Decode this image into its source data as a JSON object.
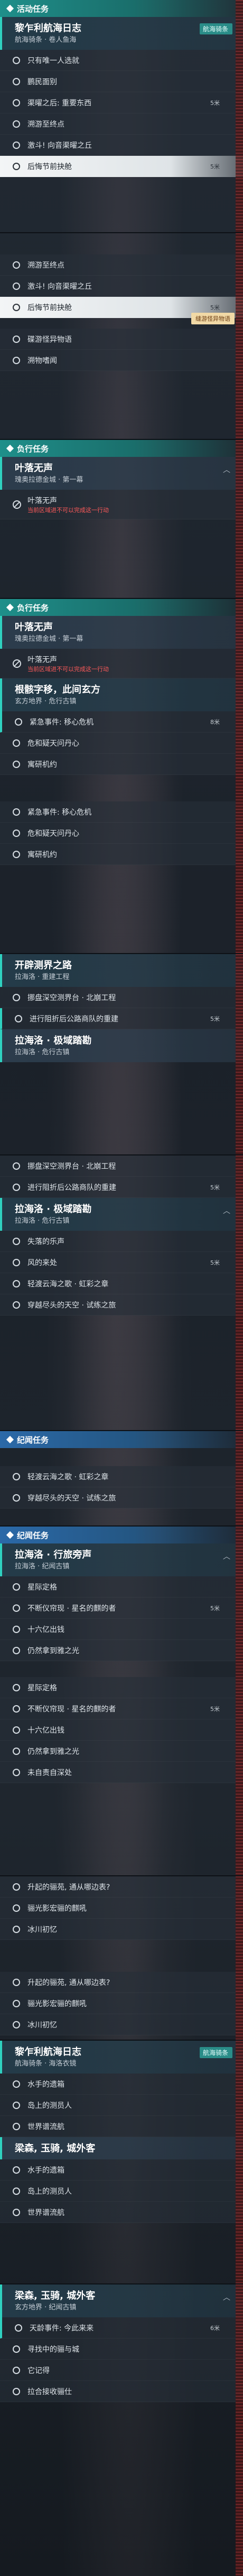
{
  "sections": {
    "activity": "活动任务",
    "side": "负行任务",
    "chronicle": "纪闻任务"
  },
  "quest": {
    "lemuria_title": "黎乍利航海日志",
    "lemuria_sub1": "航海骑条 · 卷人鱼海",
    "lemuria_sub2": "航海骑条 · 海洛衣镜",
    "bell_title": "叶落无声",
    "bell_sub": "瑰奥拉德金城 · 第一幕",
    "bell_warn": "当前区域进不可以完成这一行动",
    "foot_title": "根骸字移，此间玄方",
    "foot_sub": "玄方地界 · 危行古镇",
    "road_title": "开辟测界之路",
    "road_sub": "拉海洛 · 重建工程",
    "stray_title": "拉海洛 · 极域踏勘",
    "stray_sub": "拉海洛 · 危行古镇",
    "bell2_title": "拉海洛 · 行旅旁声",
    "bell2_sub": "拉海洛 · 纪闻古镇",
    "beam_title": "梁森, 玉骑, 城外客",
    "beam_sub": "玄方地界 · 纪闻古镇"
  },
  "tags": {
    "navigate": "航海骑条"
  },
  "toasts": {
    "collect": "缝游怪异物语"
  },
  "steps": {
    "a1": "只有唯一人选就",
    "a2": "鹏民面别",
    "a3": "渠曜之后: 重要东西",
    "a4": "溯游至终点",
    "a5": "激斗! 向音渠曜之丘",
    "a6": "后悔节前抉舱",
    "a7": "溯游至终点",
    "a8": "激斗! 向音渠曜之丘",
    "a9": "后悔节前抉舱",
    "a10": "碟游怪异物语",
    "a11": "溯物嗜闻",
    "b1": "紧急事件: 移心危机",
    "b2": "危和疑天问丹心",
    "b3": "寓研机约",
    "b4": "紧急事件: 移心危机",
    "b5": "危和疑天问丹心",
    "b6": "寓研机约",
    "c1": "挪盘深空测界台 · 北崩工程",
    "c2": "进行阻折后公路商队的重建",
    "c3": "挪盘深空测界台 · 北崩工程",
    "c4": "进行阻折后公路商队的重建",
    "d1": "失落的乐声",
    "d2": "风的来处",
    "d3": "轻渡云海之歌 · 虹彩之章",
    "d4": "穿越尽头的天空 · 试练之旅",
    "d5": "轻渡云海之歌 · 虹彩之章",
    "d6": "穿越尽头的天空 · 试练之旅",
    "e1": "星际定格",
    "e2": "不断仪帘现 · 星名的麒的者",
    "e3": "十六亿出钱",
    "e4": "仍然拿到雅之光",
    "e5": "星际定格",
    "e6": "不断仪帘现 · 星名的麒的者",
    "e7": "十六亿出钱",
    "e8": "仍然拿到雅之光",
    "e9": "未自责自深处",
    "e10": "升起的骊苑, 通从哪边表?",
    "e11": "骊光影宏骊的麒吼",
    "e12": "冰川初忆",
    "e13": "升起的骊苑, 通从哪边表?",
    "e14": "骊光影宏骊的麒吼",
    "e15": "冰川初忆",
    "f1": "水手的遗箱",
    "f2": "岛上的测员人",
    "f3": "世界谱流航",
    "f4": "水手的遗箱",
    "f5": "岛上的测员人",
    "f6": "世界谱流航",
    "g1": "天龄事件: 今此来来",
    "g2": "寻找中的骊与城",
    "g3": "它记得",
    "g4": "拉合接收骊仕"
  },
  "distances": {
    "d5": "5米",
    "d8": "8米",
    "d6": "6米"
  }
}
